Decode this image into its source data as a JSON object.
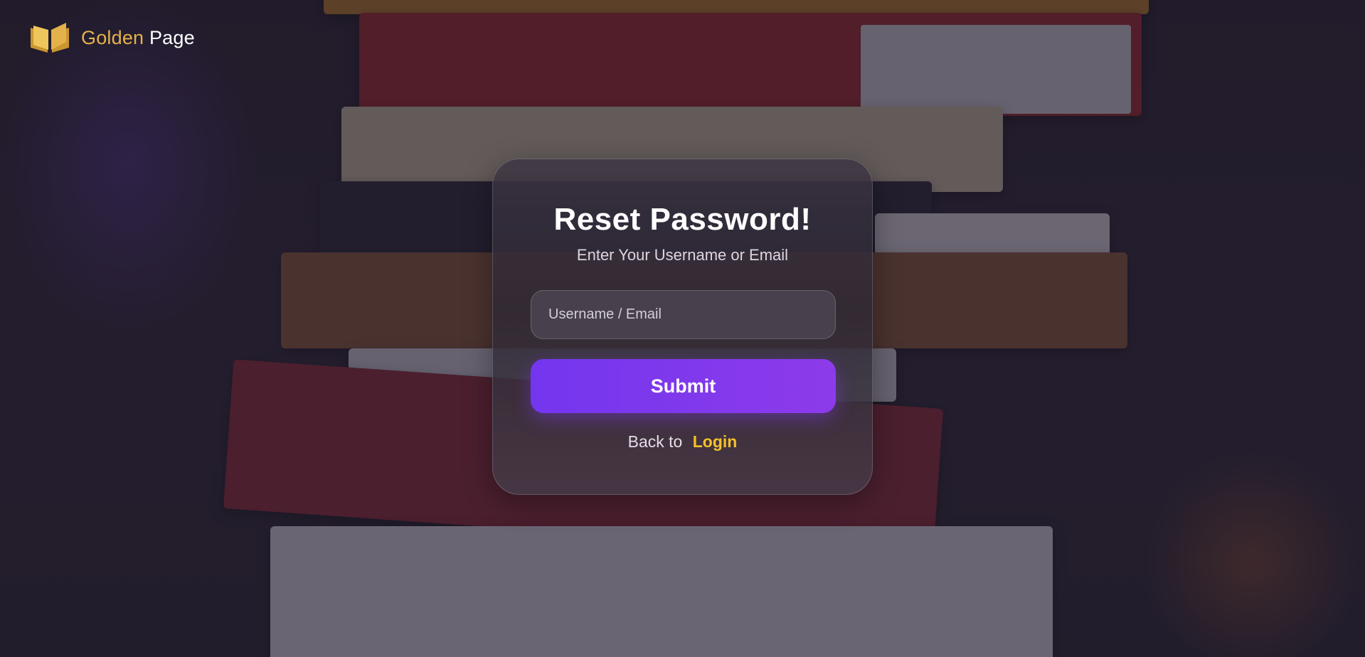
{
  "brand": {
    "name_part1": "Golden",
    "name_part2": "Page",
    "icon": "open-book-icon",
    "gold_color": "#e4b24a"
  },
  "form": {
    "title": "Reset Password!",
    "subtitle": "Enter Your Username or Email",
    "input_placeholder": "Username / Email",
    "input_value": "",
    "submit_label": "Submit",
    "back_text": "Back to",
    "login_link": "Login"
  },
  "colors": {
    "accent": "#7c3aed",
    "link": "#f2c12c"
  }
}
